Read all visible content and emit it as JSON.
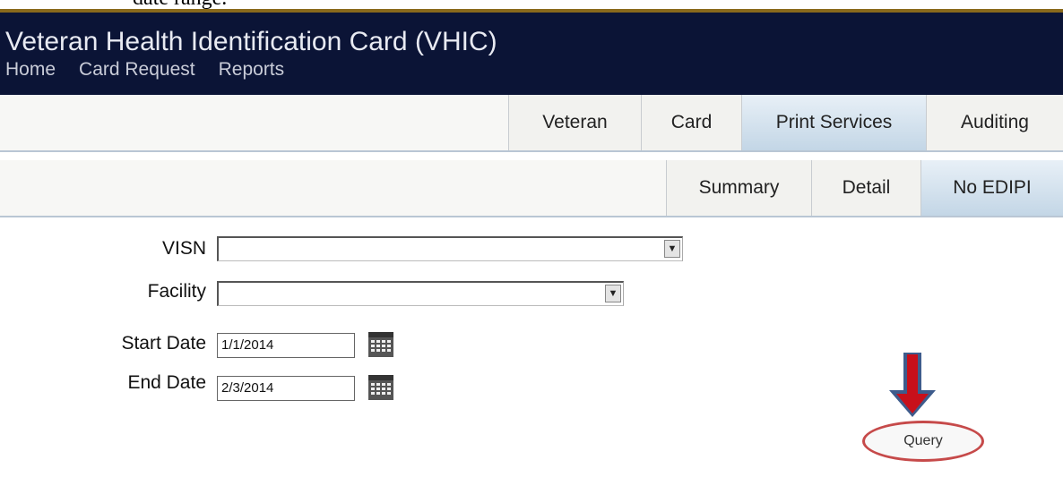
{
  "doc_snippet": "date range.",
  "app": {
    "title": "Veteran Health Identification Card (VHIC)"
  },
  "nav": {
    "items": [
      "Home",
      "Card Request",
      "Reports"
    ]
  },
  "main_tabs": {
    "items": [
      "Veteran",
      "Card",
      "Print Services",
      "Auditing"
    ],
    "active": "Print Services"
  },
  "sub_tabs": {
    "items": [
      "Summary",
      "Detail",
      "No EDIPI"
    ],
    "active": "No EDIPI"
  },
  "form": {
    "visn_label": "VISN",
    "visn_value": "",
    "facility_label": "Facility",
    "facility_value": "",
    "start_label": "Start Date",
    "start_value": "1/1/2014",
    "end_label": "End Date",
    "end_value": "2/3/2014"
  },
  "query": {
    "label": "Query"
  },
  "colors": {
    "header_bg": "#0b1436",
    "active_tab": "#c3d6e6",
    "highlight_ring": "#c64a4a",
    "arrow_red": "#c8101a",
    "arrow_blue": "#3e5c8c"
  },
  "icons": {
    "calendar": "calendar-icon",
    "select_arrow": "chevron-down-icon",
    "callout": "down-arrow-icon"
  }
}
